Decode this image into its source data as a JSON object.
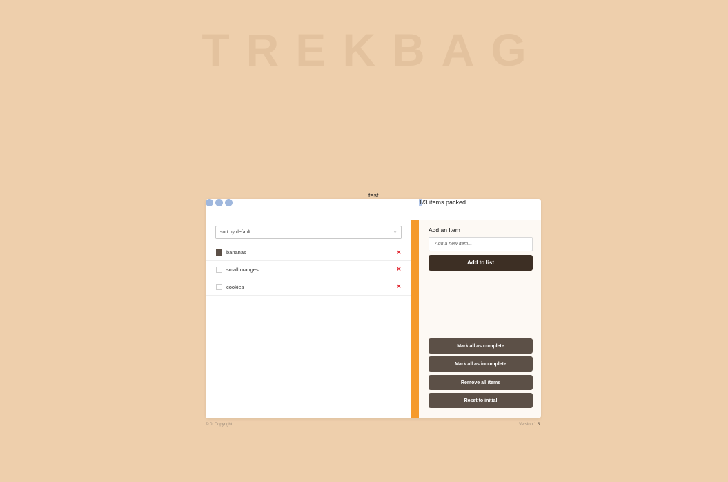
{
  "background_title": "TREKBAG",
  "test_label": "test",
  "header": {
    "packed_count": "1",
    "counter_rest": "/3 items packed"
  },
  "sort": {
    "selected": "sort by default"
  },
  "items": [
    {
      "name": "bananas",
      "packed": true,
      "delete_icon": "×"
    },
    {
      "name": "small oranges",
      "packed": false,
      "delete_icon": "×"
    },
    {
      "name": "cookies",
      "packed": false,
      "delete_icon": "×"
    }
  ],
  "sidebar": {
    "heading": "Add an Item",
    "input_placeholder": "Add a new item...",
    "add_button": "Add to list",
    "mark_complete": "Mark all as complete",
    "mark_incomplete": "Mark all as incomplete",
    "remove_all": "Remove all items",
    "reset": "Reset to initial"
  },
  "footer": {
    "copyright": "© 0. Copyright",
    "version_label": "Version",
    "version_number": "1.5"
  },
  "colors": {
    "background": "#eecfac",
    "accent_orange": "#f59a2b",
    "button_dark": "#3d2f24",
    "button_secondary": "#5c5047",
    "delete_red": "#e0252f"
  }
}
